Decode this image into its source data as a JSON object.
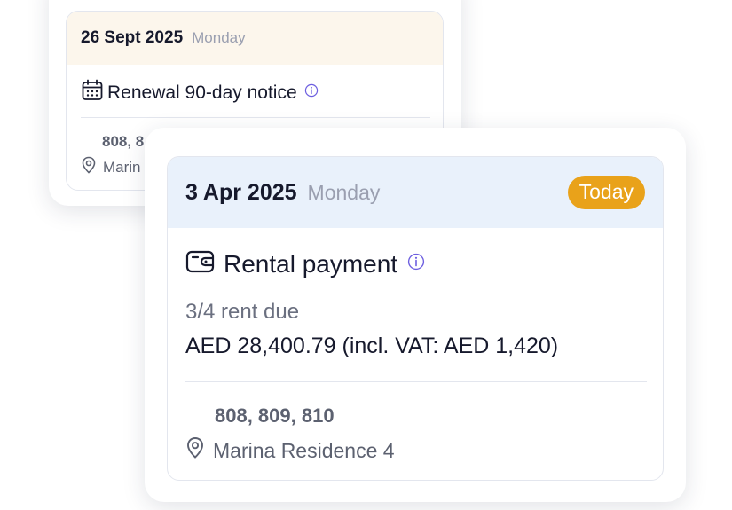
{
  "back_card": {
    "date": "26 Sept 2025",
    "weekday": "Monday",
    "title": "Renewal 90-day notice",
    "title_icon": "calendar-icon",
    "units": "808, 8",
    "location": "Marin"
  },
  "front_card": {
    "date": "3 Apr 2025",
    "weekday": "Monday",
    "badge": "Today",
    "title": "Rental payment",
    "title_icon": "wallet-icon",
    "rent_due": "3/4 rent due",
    "amount": "AED 28,400.79 (incl. VAT: AED 1,420)",
    "units": "808, 809, 810",
    "location": "Marina Residence 4"
  },
  "colors": {
    "badge": "#e9a21a",
    "back_header": "#fcf6ec",
    "front_header": "#e9f1fb",
    "info_icon": "#6d5fe0"
  }
}
